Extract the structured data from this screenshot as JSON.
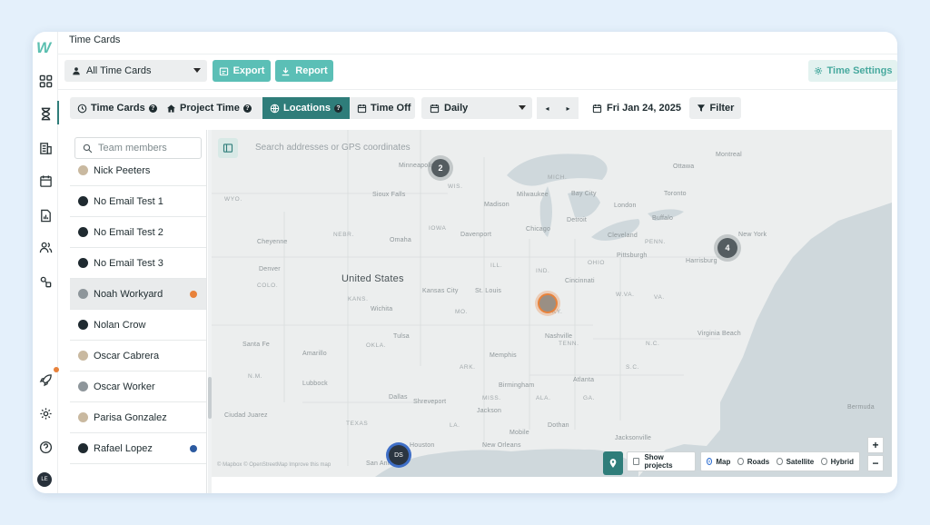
{
  "app": {
    "logo": "W",
    "page_title": "Time Cards",
    "user_initials": "LE"
  },
  "nav": {
    "icons": [
      "dashboard-icon",
      "hourglass-icon",
      "building-icon",
      "calendar-icon",
      "report-icon",
      "people-icon",
      "integrations-icon",
      "rocket-icon",
      "gear-icon",
      "help-icon"
    ]
  },
  "toolbar": {
    "filter_select": "All Time Cards",
    "export_label": "Export",
    "report_label": "Report",
    "settings_label": "Time Settings"
  },
  "tabs": [
    {
      "label": "Time Cards",
      "help": "?"
    },
    {
      "label": "Project Time",
      "help": "?"
    },
    {
      "label": "Locations",
      "help": "?"
    },
    {
      "label": "Time Off"
    }
  ],
  "period": {
    "select": "Daily",
    "prev": "◂",
    "next": "▸",
    "date": "Fri Jan 24, 2025",
    "filter_label": "Filter"
  },
  "members": {
    "search_placeholder": "Team members",
    "items": [
      {
        "name": "Nick Peeters",
        "avatar": "photo"
      },
      {
        "name": "No Email Test 1",
        "avatar": "dark"
      },
      {
        "name": "No Email Test 2",
        "avatar": "dark"
      },
      {
        "name": "No Email Test 3",
        "avatar": "dark"
      },
      {
        "name": "Noah Workyard",
        "avatar": "grey",
        "dot": "#e8823b",
        "selected": true
      },
      {
        "name": "Nolan Crow",
        "avatar": "dark"
      },
      {
        "name": "Oscar Cabrera",
        "avatar": "photo"
      },
      {
        "name": "Oscar Worker",
        "avatar": "grey"
      },
      {
        "name": "Parisa Gonzalez",
        "avatar": "photo"
      },
      {
        "name": "Rafael Lopez",
        "avatar": "dark",
        "dot": "#2c5aa0"
      }
    ]
  },
  "map": {
    "search_placeholder": "Search addresses or GPS coordinates",
    "country_label": "United States",
    "cities": [
      "Minneapolis",
      "Sioux Falls",
      "Madison",
      "Milwaukee",
      "Detroit",
      "Chicago",
      "Cleveland",
      "Pittsburgh",
      "Buffalo",
      "Toronto",
      "London",
      "Ottawa",
      "Montreal",
      "Omaha",
      "Davenport",
      "Cheyenne",
      "Denver",
      "Kansas City",
      "St. Louis",
      "Cincinnati",
      "Harrisburg",
      "New York",
      "Santa Fe",
      "Amarillo",
      "Lubbock",
      "Tulsa",
      "Dallas",
      "Memphis",
      "Nashville",
      "Atlanta",
      "Birmingham",
      "Shreveport",
      "Jackson",
      "Mobile",
      "New Orleans",
      "San Antonio",
      "Houston",
      "Jacksonville",
      "Virginia Beach",
      "Wichita",
      "Ciudad Juarez",
      "Bermuda",
      "Bay City",
      "Dothan"
    ],
    "states": [
      "WYO.",
      "NEBR.",
      "IOWA",
      "ILL.",
      "IND.",
      "OHIO",
      "PENN.",
      "COLO.",
      "KANS.",
      "MO.",
      "KY.",
      "W.VA.",
      "VA.",
      "N.M.",
      "OKLA.",
      "ARK.",
      "TENN.",
      "N.C.",
      "S.C.",
      "MISS.",
      "ALA.",
      "GA.",
      "TEXAS",
      "LA.",
      "MICH.",
      "WIS."
    ],
    "clusters": [
      {
        "count": "2"
      },
      {
        "count": "4"
      }
    ],
    "pin_ds": "DS",
    "attribution": "© Mapbox © OpenStreetMap Improve this map",
    "show_projects_label": "Show projects",
    "map_types": [
      "Map",
      "Roads",
      "Satellite",
      "Hybrid"
    ],
    "map_type_selected": "Map",
    "zoom_in": "+",
    "zoom_out": "−"
  },
  "colors": {
    "accent": "#2f7d7a",
    "teal_button": "#5bbfb6",
    "orange_status": "#e8823b",
    "blue_status": "#2c5aa0"
  }
}
